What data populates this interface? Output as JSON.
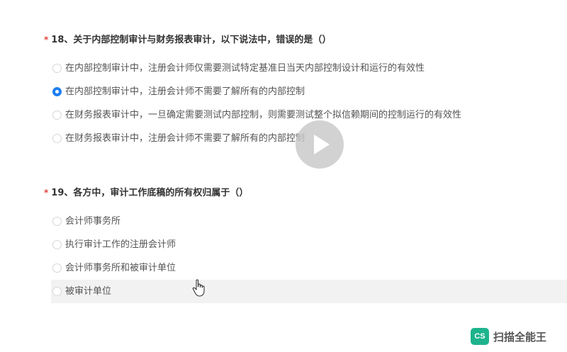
{
  "questions": [
    {
      "required_mark": "*",
      "title": "18、关于内部控制审计与财务报表审计，以下说法中，错误的是（）",
      "options": [
        {
          "label": "在内部控制审计中，注册会计师仅需要测试特定基准日当天内部控制设计和运行的有效性",
          "selected": false
        },
        {
          "label": "在内部控制审计中，注册会计师不需要了解所有的内部控制",
          "selected": true
        },
        {
          "label": "在财务报表审计中，一旦确定需要测试内部控制，则需要测试整个拟信赖期间的控制运行的有效性",
          "selected": false
        },
        {
          "label": "在财务报表审计中，注册会计师不需要了解所有的内部控制",
          "selected": false
        }
      ]
    },
    {
      "required_mark": "*",
      "title": "19、各方中，审计工作底稿的所有权归属于（）",
      "options": [
        {
          "label": "会计师事务所",
          "selected": false
        },
        {
          "label": "执行审计工作的注册会计师",
          "selected": false
        },
        {
          "label": "会计师事务所和被审计单位",
          "selected": false
        },
        {
          "label": "被审计单位",
          "selected": false
        }
      ]
    }
  ],
  "watermark": {
    "logo": "CS",
    "text": "扫描全能王"
  },
  "icons": {
    "play": "play-icon",
    "cursor": "hand-cursor-icon",
    "logo": "camscanner-logo-icon"
  },
  "colors": {
    "accent": "#1e7ff0",
    "required": "#e0443c",
    "hover_bg": "#f2f2f2",
    "watermark_logo": "#1db38d"
  }
}
